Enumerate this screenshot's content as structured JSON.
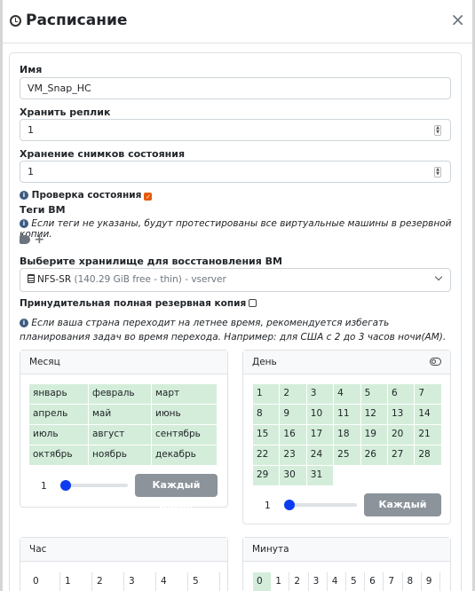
{
  "dialog": {
    "title": "Расписание",
    "close": "×"
  },
  "form": {
    "name_label": "Имя",
    "name_value": "VM_Snap_HC",
    "replicas_label": "Хранить реплик",
    "replicas_value": "1",
    "snapshots_label": "Хранение снимков состояния",
    "snapshots_value": "1",
    "health_check_label": "Проверка состояния",
    "health_check_checked": true,
    "tags_label": "Теги ВМ",
    "tags_hint": "Если теги не указаны, будут протестированы все виртуальные машины в резервной копии.",
    "storage_label": "Выберите хранилище для восстановления ВМ",
    "storage_name": "NFS-SR",
    "storage_detail": "(140.29 GiB free - thin)",
    "storage_server": "- vserver",
    "force_full_label": "Принудительная полная резервная копия",
    "force_full_checked": false,
    "dst_hint": "Если ваша страна переходит на летнее время, рекомендуется избегать планирования задач во время перехода. Например: для США с 2 до 3 часов ночи(AM)."
  },
  "month_panel": {
    "title": "Месяц",
    "months": [
      "январь",
      "февраль",
      "март",
      "апрель",
      "май",
      "июнь",
      "июль",
      "август",
      "сентябрь",
      "октябрь",
      "ноябрь",
      "декабрь"
    ],
    "step": "1",
    "button": "Каждый месяц"
  },
  "day_panel": {
    "title": "День",
    "days": [
      "1",
      "2",
      "3",
      "4",
      "5",
      "6",
      "7",
      "8",
      "9",
      "10",
      "11",
      "12",
      "13",
      "14",
      "15",
      "16",
      "17",
      "18",
      "19",
      "20",
      "21",
      "22",
      "23",
      "24",
      "25",
      "26",
      "27",
      "28",
      "29",
      "30",
      "31"
    ],
    "step": "1",
    "button": "Каждый день"
  },
  "hour_panel": {
    "title": "Час",
    "hours": [
      "0",
      "1",
      "2",
      "3",
      "4",
      "5"
    ]
  },
  "minute_panel": {
    "title": "Минута",
    "minutes": [
      "0",
      "1",
      "2",
      "3",
      "4",
      "5",
      "6",
      "7",
      "8",
      "9"
    ]
  }
}
